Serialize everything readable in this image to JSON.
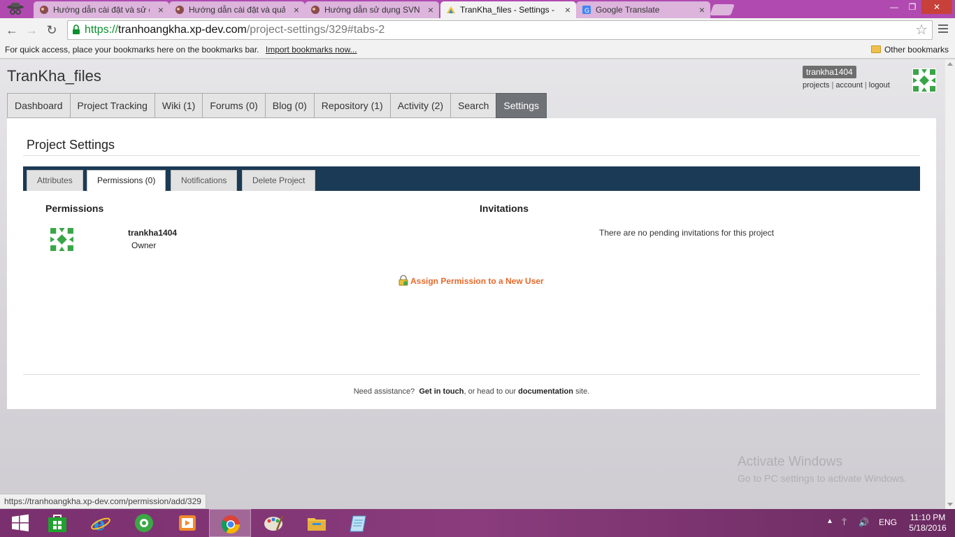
{
  "browser": {
    "tabs": [
      {
        "title": "Hướng dẫn cài đặt và sử dụng"
      },
      {
        "title": "Hướng dẫn cài đặt và quản"
      },
      {
        "title": "Hướng dẫn sử dụng SVN"
      },
      {
        "title": "TranKha_files - Settings -"
      },
      {
        "title": "Google Translate"
      }
    ],
    "close_glyph": "×",
    "url": {
      "scheme": "https://",
      "host": "tranhoangkha.xp-dev.com",
      "path": "/project-settings/329#tabs-2"
    },
    "bookmarks": {
      "hint": "For quick access, place your bookmarks here on the bookmarks bar.",
      "import_link": "Import bookmarks now...",
      "other": "Other bookmarks"
    },
    "status_url": "https://tranhoangkha.xp-dev.com/permission/add/329"
  },
  "site": {
    "project_title": "TranKha_files",
    "user": {
      "name": "trankha1404",
      "links": [
        "projects",
        "account",
        "logout"
      ],
      "sep": "|"
    },
    "nav": [
      "Dashboard",
      "Project Tracking",
      "Wiki (1)",
      "Forums (0)",
      "Blog (0)",
      "Repository (1)",
      "Activity (2)",
      "Search",
      "Settings"
    ],
    "panel_title": "Project Settings",
    "subtabs": [
      "Attributes",
      "Permissions (0)",
      "Notifications",
      "Delete Project"
    ],
    "permissions": {
      "heading": "Permissions",
      "user": "trankha1404",
      "role": "Owner"
    },
    "invitations": {
      "heading": "Invitations",
      "empty": "There are no pending invitations for this project"
    },
    "assign_link": "Assign Permission to a New User",
    "footer": {
      "pre": "Need assistance?",
      "contact": "Get in touch",
      "mid": ", or head to our",
      "docs": "documentation",
      "post": "site."
    }
  },
  "watermark": {
    "line1": "Activate Windows",
    "line2": "Go to PC settings to activate Windows."
  },
  "taskbar": {
    "apps": [
      "windows-start",
      "store",
      "internet-explorer",
      "greenshot",
      "media-player",
      "chrome",
      "paint",
      "file-explorer",
      "notepad"
    ],
    "lang": "ENG",
    "time": "11:10 PM",
    "date": "5/18/2016"
  },
  "colors": {
    "tabbar": "#b04ab0",
    "nav_active": "#6f7378",
    "subbar": "#1b3a55",
    "assign_link": "#e8682a",
    "url_scheme": "#0a8f2c"
  }
}
